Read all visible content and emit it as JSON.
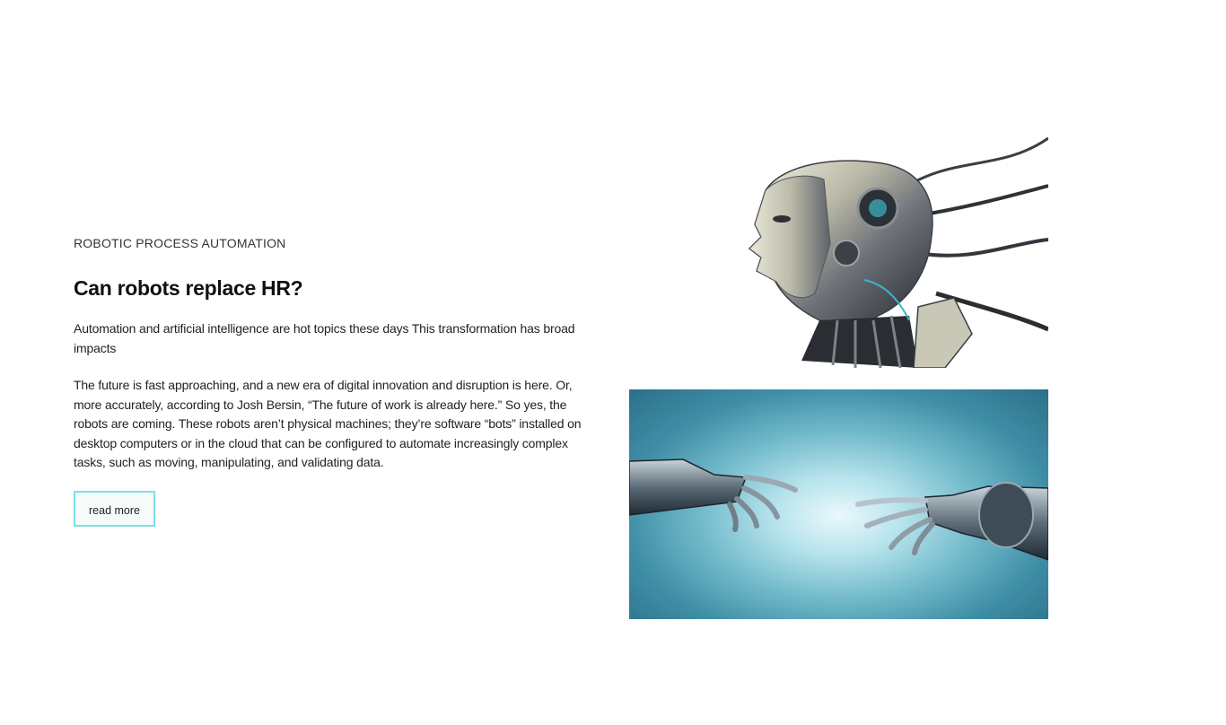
{
  "article": {
    "category": "ROBOTIC PROCESS AUTOMATION",
    "title": "Can robots replace HR?",
    "lead": "Automation and artificial intelligence are hot topics these days This transformation has broad impacts",
    "body": "The future is fast approaching, and a new era of digital innovation and disruption is here. Or, more accurately, according to Josh Bersin, “The future of work is already here.” So yes, the robots are coming. These robots aren’t physical machines; they’re software “bots” installed on desktop computers or in the cloud that can be configured to automate increasingly complex tasks, such as moving, manipulating, and validating data.",
    "read_more_label": "read more"
  },
  "images": {
    "robot_head": "robot-head-image",
    "robot_hands": "robot-hands-image"
  },
  "colors": {
    "button_border": "#7fe0e0",
    "hands_background": "#4fa3b8"
  }
}
